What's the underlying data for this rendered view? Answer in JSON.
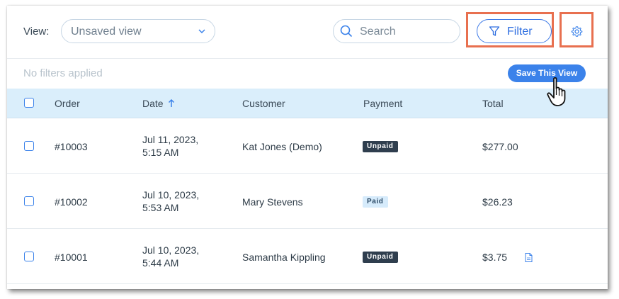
{
  "toolbar": {
    "view_label": "View:",
    "view_value": "Unsaved view",
    "search_placeholder": "Search",
    "filter_label": "Filter"
  },
  "subbar": {
    "status": "No filters applied",
    "save_view_label": "Save This View"
  },
  "table": {
    "headers": {
      "order": "Order",
      "date": "Date",
      "customer": "Customer",
      "payment": "Payment",
      "total": "Total"
    },
    "rows": [
      {
        "order": "#10003",
        "date_line1": "Jul 11, 2023,",
        "date_line2": "5:15 AM",
        "customer": "Kat Jones (Demo)",
        "payment": "Unpaid",
        "total": "$277.00"
      },
      {
        "order": "#10002",
        "date_line1": "Jul 10, 2023,",
        "date_line2": "5:53 AM",
        "customer": "Mary Stevens",
        "payment": "Paid",
        "total": "$26.23"
      },
      {
        "order": "#10001",
        "date_line1": "Jul 10, 2023,",
        "date_line2": "5:44 AM",
        "customer": "Samantha Kippling",
        "payment": "Unpaid",
        "total": "$3.75"
      }
    ]
  },
  "colors": {
    "accent": "#3b82ea",
    "highlight": "#e8704f",
    "header_bg": "#daeefb"
  },
  "icons": [
    "chevron-down-icon",
    "search-icon",
    "filter-icon",
    "gear-icon",
    "sort-up-arrow-icon",
    "hand-cursor-icon",
    "document-icon"
  ]
}
